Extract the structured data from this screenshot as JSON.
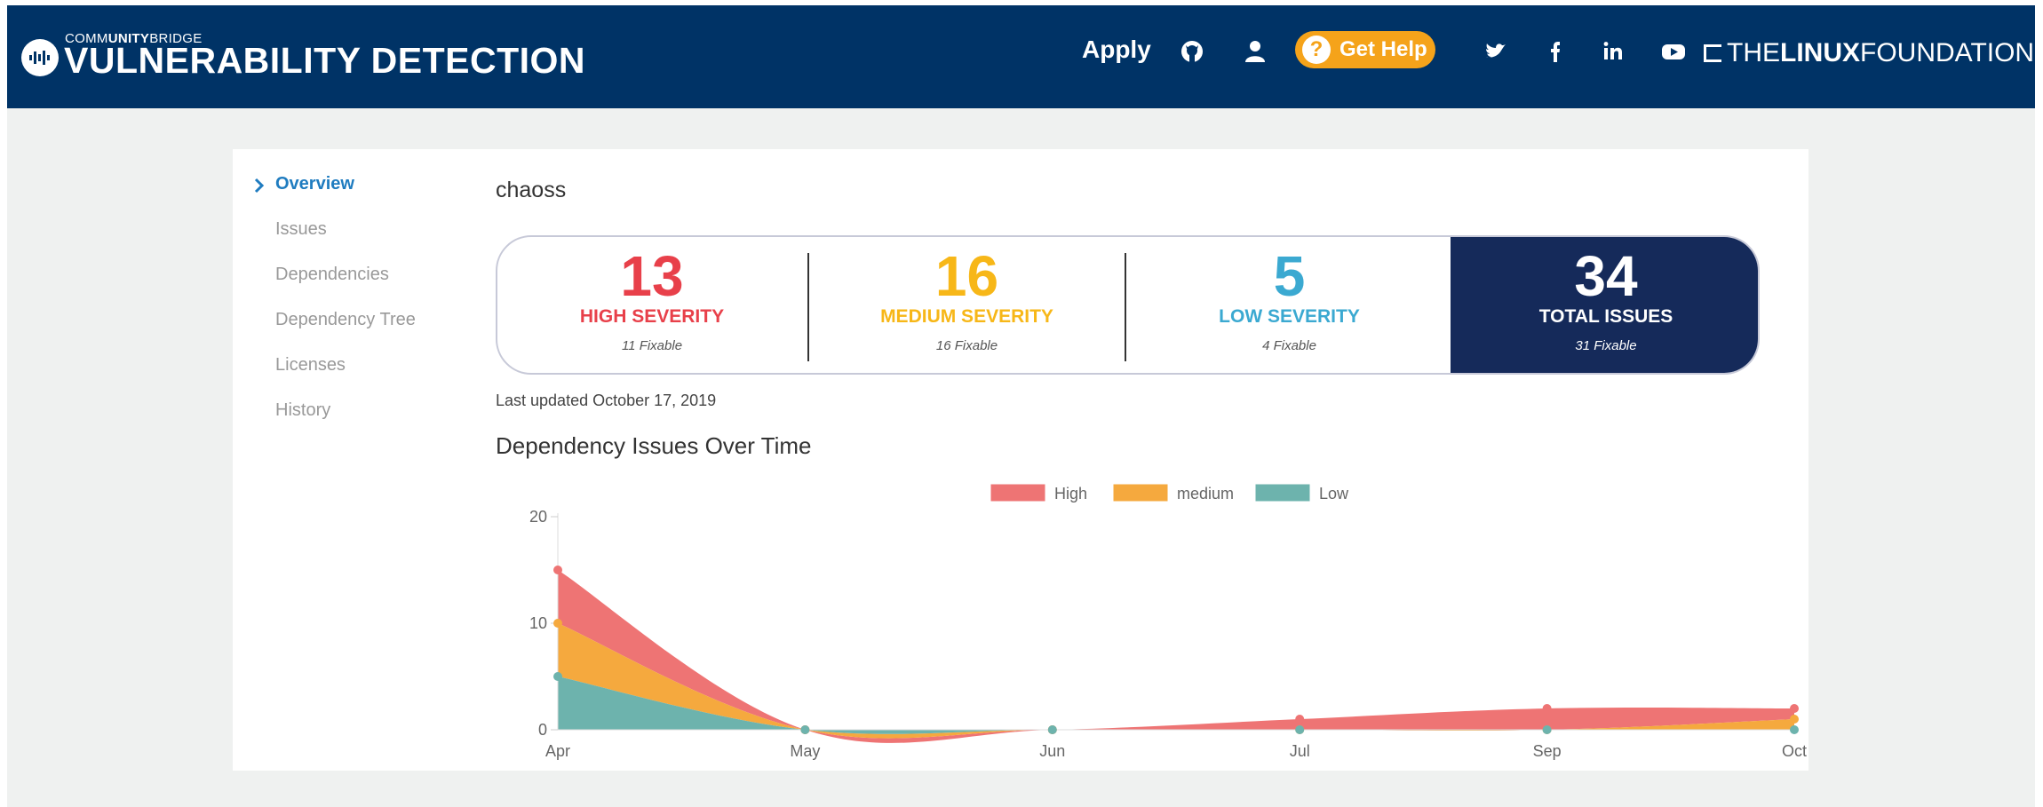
{
  "header": {
    "brand_prefix": "COMMUNITYBRIDGE",
    "brand_prefix_light_a": "COMM",
    "brand_prefix_bold": "UNITY",
    "brand_prefix_light_b": "BRIDGE",
    "brand_title": "VULNERABILITY DETECTION",
    "apply_label": "Apply",
    "get_help_label": "Get Help",
    "get_help_glyph": "?",
    "lf_light_a": "THE",
    "lf_bold": "LINUX",
    "lf_light_b": "FOUNDATION",
    "icons": [
      "github-icon",
      "user-icon",
      "twitter-icon",
      "facebook-icon",
      "linkedin-icon",
      "youtube-icon",
      "linux-foundation-logo"
    ],
    "colors": {
      "bar": "#003366",
      "help": "#f5a31a"
    }
  },
  "sidebar": {
    "items": [
      {
        "label": "Overview",
        "active": true
      },
      {
        "label": "Issues"
      },
      {
        "label": "Dependencies"
      },
      {
        "label": "Dependency Tree"
      },
      {
        "label": "Licenses"
      },
      {
        "label": "History"
      }
    ]
  },
  "project": {
    "name": "chaoss"
  },
  "stats": [
    {
      "value": "13",
      "label": "HIGH SEVERITY",
      "fixable": "11 Fixable",
      "color": "#e8404a"
    },
    {
      "value": "16",
      "label": "MEDIUM SEVERITY",
      "fixable": "16 Fixable",
      "color": "#f7b718"
    },
    {
      "value": "5",
      "label": "LOW SEVERITY",
      "fixable": "4 Fixable",
      "color": "#3ba9d1"
    },
    {
      "value": "34",
      "label": "TOTAL ISSUES",
      "fixable": "31 Fixable",
      "color": "#ffffff"
    }
  ],
  "last_updated": "Last updated October 17, 2019",
  "chart_title": "Dependency Issues Over Time",
  "chart_data": {
    "type": "area",
    "stacked": true,
    "categories": [
      "Apr",
      "May",
      "Jun",
      "Jul",
      "Sep",
      "Oct"
    ],
    "series": [
      {
        "name": "High",
        "values": [
          5,
          0,
          0,
          1,
          2,
          1
        ],
        "color": "#ee7474"
      },
      {
        "name": "medium",
        "values": [
          5,
          0,
          0,
          0,
          0,
          1
        ],
        "color": "#f5a93e"
      },
      {
        "name": "Low",
        "values": [
          5,
          0,
          0,
          0,
          0,
          0
        ],
        "color": "#6db3ad"
      }
    ],
    "yticks": [
      0,
      10,
      20
    ],
    "ylim": [
      0,
      20
    ],
    "legend_position": "top-center",
    "grid": false
  }
}
